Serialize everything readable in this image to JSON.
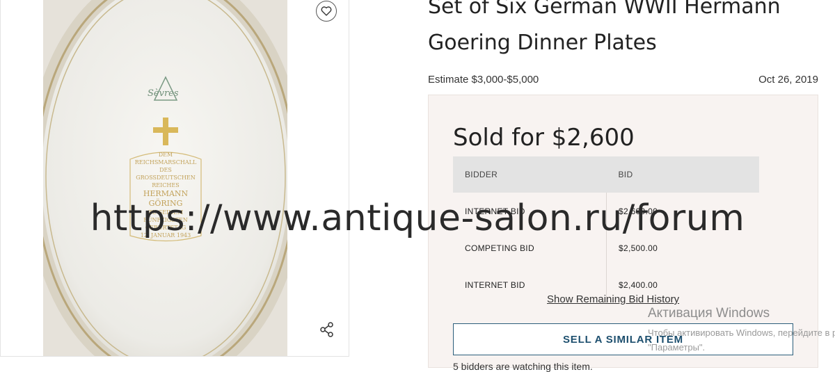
{
  "lot": {
    "title": "Set of Six German WWII Hermann Goering Dinner Plates",
    "estimate": "Estimate $3,000-$5,000",
    "date": "Oct 26, 2019",
    "sold_for": "Sold for $2,600"
  },
  "plate_inscription": [
    "DEM",
    "REICHSMARSCHALL",
    "DES",
    "GROSSDEUTSCHEN",
    "REICHES",
    "HERMANN",
    "GÖRING",
    "ZU SEINEM",
    "FÜNFZIGSTEN",
    "GEBURTSTAG",
    "12. JANUAR 1943"
  ],
  "plate_logo": "Sèvres",
  "bids": {
    "headers": [
      "BIDDER",
      "BID"
    ],
    "rows": [
      {
        "bidder": "INTERNET BID",
        "bid": "$2,600.00"
      },
      {
        "bidder": "COMPETING BID",
        "bid": "$2,500.00"
      },
      {
        "bidder": "INTERNET BID",
        "bid": "$2,400.00"
      }
    ]
  },
  "actions": {
    "show_history": "Show Remaining Bid History",
    "sell_similar": "SELL A SIMILAR ITEM",
    "watching": "5 bidders are watching this item."
  },
  "icons": {
    "favorite": "heart-icon",
    "share": "share-icon"
  },
  "overlay": {
    "watermark": "https://www.antique-salon.ru/forum",
    "windows_title": "Активация Windows",
    "windows_line1": "Чтобы активировать Windows, перейдите в раздел",
    "windows_line2": "\"Параметры\"."
  },
  "colors": {
    "accent": "#1d4f6e",
    "panel_bg": "#f8f3f1",
    "table_header_bg": "#e3e3e3"
  }
}
